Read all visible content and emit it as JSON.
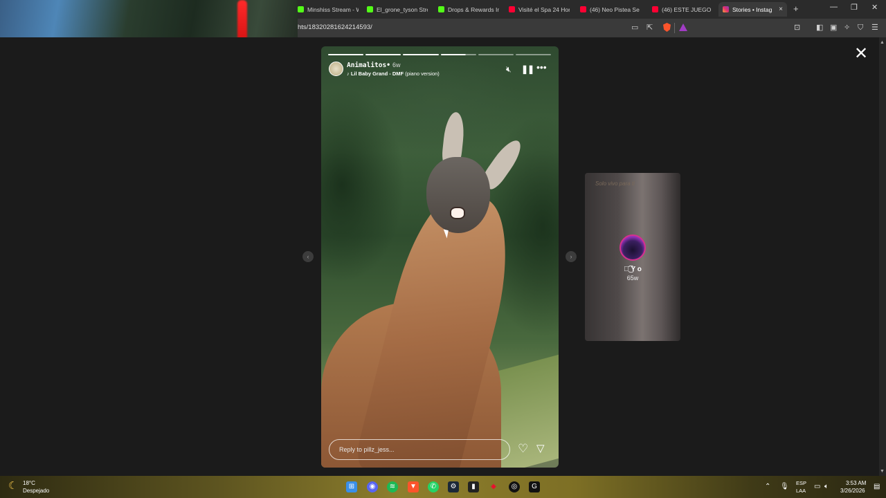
{
  "browser": {
    "tabs": [
      {
        "label": "Minshiss Stream - W",
        "color": "#53fc18"
      },
      {
        "label": "El_grone_tyson Stre",
        "color": "#53fc18"
      },
      {
        "label": "Drops & Rewards In",
        "color": "#53fc18"
      },
      {
        "label": "Visité el Spa 24 Hor",
        "color": "#ff0033"
      },
      {
        "label": "(46) Neo Pistea Se I",
        "color": "#ff0033"
      },
      {
        "label": "(46) ESTE JUEGO DE",
        "color": "#ff0033"
      },
      {
        "label": "Stories • Instag",
        "color": "#e1306c",
        "active": true
      }
    ],
    "new_tab": "+",
    "close_tab": "×",
    "url": "hts/18320281624214593/"
  },
  "story": {
    "progress": {
      "segments": 6,
      "completed": 3,
      "current_fraction": 0.7
    },
    "username": "Animalitos•",
    "time_ago": "6w",
    "music": "Lil Baby Grand - DMF",
    "music_suffix": " (piano version)",
    "reply_placeholder": "Reply to pillz_jess..."
  },
  "next_story": {
    "caption": "Solo vivo para ti",
    "name": "ꨄ͜͡ Y o",
    "time_ago": "65w"
  },
  "taskbar": {
    "weather_temp": "18°C",
    "weather_desc": "Despejado",
    "lang_top": "ESP",
    "lang_bottom": "LAA",
    "time": "3:53 AM",
    "date": "3/26/2026"
  }
}
